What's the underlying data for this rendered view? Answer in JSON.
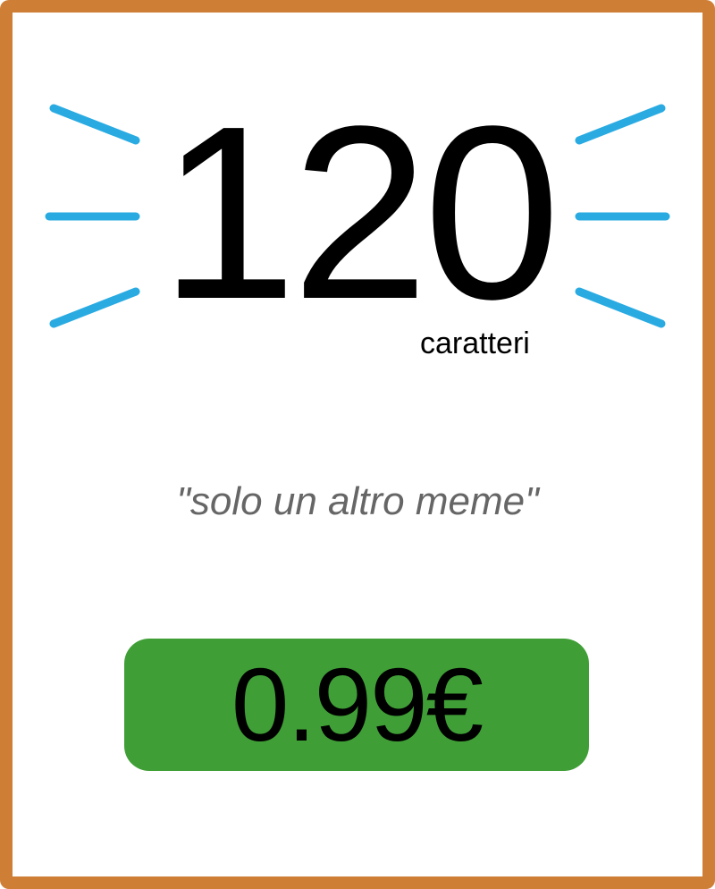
{
  "counter": {
    "value": "120",
    "unit": "caratteri"
  },
  "tagline": "\"solo un altro meme\"",
  "price": {
    "label": "0.99€",
    "color": "#3f9f36"
  },
  "colors": {
    "frame": "#ce7f35",
    "rays": "#29abe2",
    "tagline": "#666666"
  }
}
